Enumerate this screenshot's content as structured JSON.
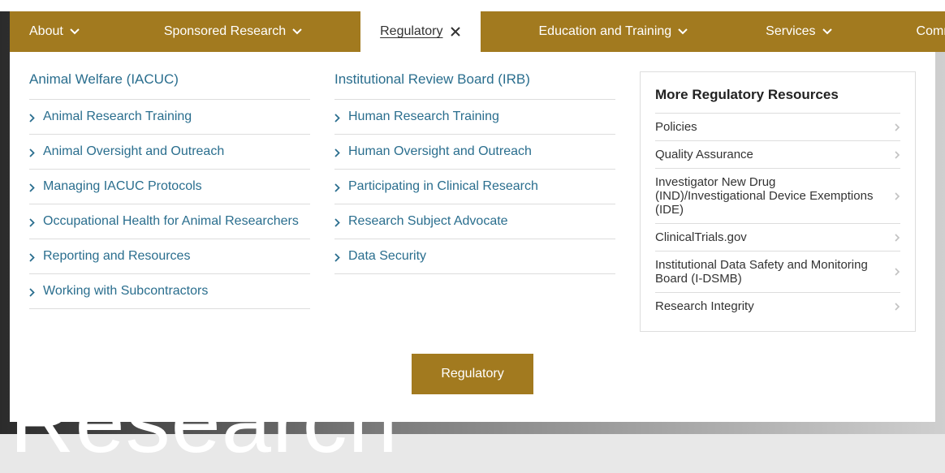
{
  "nav": {
    "items": [
      {
        "label": "About",
        "has_dropdown": true,
        "active": false
      },
      {
        "label": "Sponsored Research",
        "has_dropdown": true,
        "active": false
      },
      {
        "label": "Regulatory",
        "has_dropdown": true,
        "active": true
      },
      {
        "label": "Education and Training",
        "has_dropdown": true,
        "active": false
      },
      {
        "label": "Services",
        "has_dropdown": true,
        "active": false
      },
      {
        "label": "Community Resources",
        "has_dropdown": false,
        "active": false
      }
    ]
  },
  "menu": {
    "columns": [
      {
        "heading": "Animal Welfare (IACUC)",
        "links": [
          "Animal Research Training",
          "Animal Oversight and Outreach",
          "Managing IACUC Protocols",
          "Occupational Health for Animal Researchers",
          "Reporting and Resources",
          "Working with Subcontractors"
        ]
      },
      {
        "heading": "Institutional Review Board (IRB)",
        "links": [
          "Human Research Training",
          "Human Oversight and Outreach",
          "Participating in Clinical Research",
          "Research Subject Advocate",
          "Data Security"
        ]
      }
    ],
    "sidebar": {
      "heading": "More Regulatory Resources",
      "links": [
        "Policies",
        "Quality Assurance",
        "Investigator New Drug (IND)/Investigational Device Exemptions (IDE)",
        "ClinicalTrials.gov",
        "Institutional Data Safety and Monitoring Board (I-DSMB)",
        "Research Integrity"
      ]
    },
    "cta_label": "Regulatory"
  },
  "background_word": "Research"
}
